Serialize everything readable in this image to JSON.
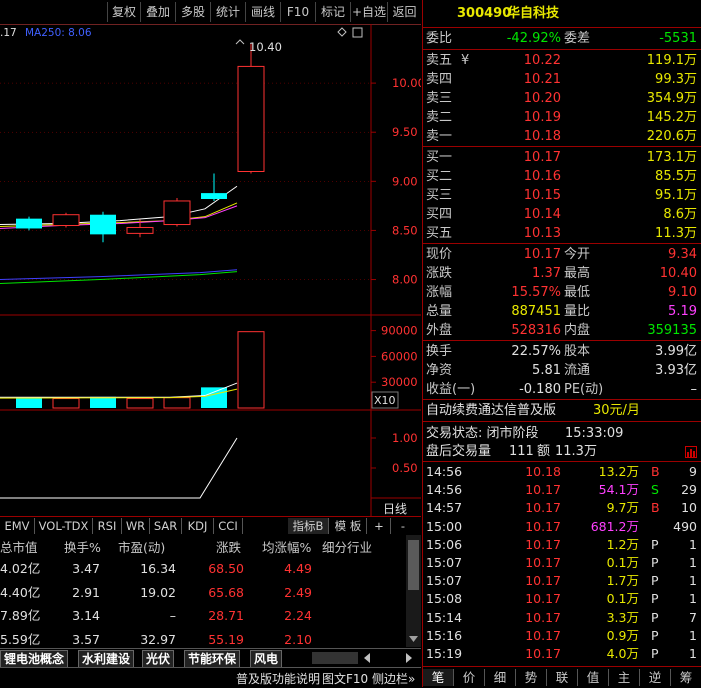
{
  "toolbar": {
    "buttons": [
      "复权",
      "叠加",
      "多股",
      "统计",
      "画线",
      "F10",
      "标记",
      "+自选",
      "返回"
    ]
  },
  "chart": {
    "ma_label_left": ".17",
    "ma_label": "MA250: 8.06",
    "high_marker": "10.40",
    "price_ticks": [
      "10.00",
      "9.50",
      "9.00",
      "8.50",
      "8.00"
    ],
    "vol_ticks": [
      "90000",
      "60000",
      "30000"
    ],
    "vol_unit": "X10",
    "ind_ticks": [
      "1.00",
      "0.50"
    ],
    "day_line_label": "日线",
    "plus": "+",
    "minus": "-"
  },
  "chart_data": {
    "type": "candlestick",
    "candles": [
      {
        "open": 8.62,
        "close": 8.52,
        "high": 8.64,
        "low": 8.5,
        "color": "cyan"
      },
      {
        "open": 8.55,
        "close": 8.66,
        "high": 8.68,
        "low": 8.53,
        "color": "red"
      },
      {
        "open": 8.66,
        "close": 8.46,
        "high": 8.69,
        "low": 8.38,
        "color": "cyan"
      },
      {
        "open": 8.47,
        "close": 8.53,
        "high": 8.61,
        "low": 8.43,
        "color": "red"
      },
      {
        "open": 8.56,
        "close": 8.8,
        "high": 8.83,
        "low": 8.54,
        "color": "red"
      },
      {
        "open": 8.88,
        "close": 8.82,
        "high": 9.08,
        "low": 8.8,
        "color": "cyan"
      },
      {
        "open": 9.1,
        "close": 10.17,
        "high": 10.4,
        "low": 9.08,
        "color": "red"
      }
    ],
    "volumes": [
      12000,
      11000,
      13000,
      11000,
      12000,
      24000,
      88745
    ],
    "indicator": [
      0,
      0,
      0,
      0,
      0,
      0.15,
      1.0
    ],
    "price_range": [
      7.7,
      10.5
    ],
    "vol_range": [
      0,
      100000
    ],
    "ind_range": [
      0,
      1.4
    ]
  },
  "indicator_tabs": [
    "EMV",
    "VOL-TDX",
    "RSI",
    "WR",
    "SAR",
    "KDJ",
    "CCI"
  ],
  "indicator_right": {
    "index_btn": "指标B",
    "template_btn": "模 板",
    "plus": "+",
    "minus": "-"
  },
  "block_table": {
    "headers": [
      "总市值",
      "换手%",
      "市盈(动)",
      "涨跌",
      "均涨幅%",
      "细分行业"
    ],
    "rows": [
      {
        "mcap": "4.02亿",
        "turnover": "3.47",
        "pe": "16.34",
        "change": "68.50",
        "avg": "4.49"
      },
      {
        "mcap": "4.40亿",
        "turnover": "2.91",
        "pe": "19.02",
        "change": "65.68",
        "avg": "2.49"
      },
      {
        "mcap": "7.89亿",
        "turnover": "3.14",
        "pe": "–",
        "change": "28.71",
        "avg": "2.24"
      },
      {
        "mcap": "5.59亿",
        "turnover": "3.57",
        "pe": "32.97",
        "change": "55.19",
        "avg": "2.10"
      }
    ]
  },
  "sector_tabs": [
    "锂电池概念",
    "水利建设",
    "光伏",
    "节能环保",
    "风电"
  ],
  "bottom_strip": {
    "help": "普及版功能说明",
    "f10": "图文F10",
    "sidebar": "侧边栏»"
  },
  "quote": {
    "code": "300490",
    "name": "华自科技",
    "webi_label": "委比",
    "webi": "-42.92%",
    "weicha_label": "委差",
    "weicha": "-5531",
    "asks": [
      {
        "label": "卖五",
        "price": "10.22",
        "vol": "119.1万",
        "flag": "¥"
      },
      {
        "label": "卖四",
        "price": "10.21",
        "vol": "99.3万"
      },
      {
        "label": "卖三",
        "price": "10.20",
        "vol": "354.9万"
      },
      {
        "label": "卖二",
        "price": "10.19",
        "vol": "145.2万"
      },
      {
        "label": "卖一",
        "price": "10.18",
        "vol": "220.6万"
      }
    ],
    "bids": [
      {
        "label": "买一",
        "price": "10.17",
        "vol": "173.1万"
      },
      {
        "label": "买二",
        "price": "10.16",
        "vol": "85.5万"
      },
      {
        "label": "买三",
        "price": "10.15",
        "vol": "95.1万"
      },
      {
        "label": "买四",
        "price": "10.14",
        "vol": "8.6万"
      },
      {
        "label": "买五",
        "price": "10.13",
        "vol": "11.3万"
      }
    ],
    "stats": [
      {
        "l1": "现价",
        "v1": "10.17",
        "c1": "red",
        "l2": "今开",
        "v2": "9.34",
        "c2": "red"
      },
      {
        "l1": "涨跌",
        "v1": "1.37",
        "c1": "red",
        "l2": "最高",
        "v2": "10.40",
        "c2": "red"
      },
      {
        "l1": "涨幅",
        "v1": "15.57%",
        "c1": "red",
        "l2": "最低",
        "v2": "9.10",
        "c2": "red"
      },
      {
        "l1": "总量",
        "v1": "887451",
        "c1": "yellow",
        "l2": "量比",
        "v2": "5.19",
        "c2": "magenta"
      },
      {
        "l1": "外盘",
        "v1": "528316",
        "c1": "red",
        "l2": "内盘",
        "v2": "359135",
        "c2": "green"
      }
    ],
    "fin": [
      {
        "l1": "换手",
        "v1": "22.57%",
        "l2": "股本",
        "v2": "3.99亿"
      },
      {
        "l1": "净资",
        "v1": "5.81",
        "l2": "流通",
        "v2": "3.93亿"
      },
      {
        "l1": "收益(一)",
        "v1": "-0.180",
        "l2": "PE(动)",
        "v2": "–"
      }
    ],
    "ad_text": "自动续费通达信普及版",
    "ad_price": "30元/月",
    "status_label": "交易状态: 闭市阶段",
    "status_time": "15:33:09",
    "after_label": "盘后交易量",
    "after_vol": "111",
    "after_amt_label": "额",
    "after_amt": "11.3万"
  },
  "ticks": [
    {
      "time": "14:56",
      "price": "10.18",
      "vol": "13.2万",
      "bs": "B",
      "n": "9",
      "vc": "yellow",
      "bc": "red"
    },
    {
      "time": "14:56",
      "price": "10.17",
      "vol": "54.1万",
      "bs": "S",
      "n": "29",
      "vc": "magenta",
      "bc": "green"
    },
    {
      "time": "14:57",
      "price": "10.17",
      "vol": "9.7万",
      "bs": "B",
      "n": "10",
      "vc": "yellow",
      "bc": "red"
    },
    {
      "time": "15:00",
      "price": "10.17",
      "vol": "681.2万",
      "bs": "",
      "n": "490",
      "vc": "magenta",
      "bc": "white"
    },
    {
      "time": "15:06",
      "price": "10.17",
      "vol": "1.2万",
      "bs": "P",
      "n": "1",
      "vc": "yellow",
      "bc": "white"
    },
    {
      "time": "15:07",
      "price": "10.17",
      "vol": "0.1万",
      "bs": "P",
      "n": "1",
      "vc": "yellow",
      "bc": "white"
    },
    {
      "time": "15:07",
      "price": "10.17",
      "vol": "1.7万",
      "bs": "P",
      "n": "1",
      "vc": "yellow",
      "bc": "white"
    },
    {
      "time": "15:08",
      "price": "10.17",
      "vol": "0.1万",
      "bs": "P",
      "n": "1",
      "vc": "yellow",
      "bc": "white"
    },
    {
      "time": "15:14",
      "price": "10.17",
      "vol": "3.3万",
      "bs": "P",
      "n": "7",
      "vc": "yellow",
      "bc": "white"
    },
    {
      "time": "15:16",
      "price": "10.17",
      "vol": "0.9万",
      "bs": "P",
      "n": "1",
      "vc": "yellow",
      "bc": "white"
    },
    {
      "time": "15:19",
      "price": "10.17",
      "vol": "4.0万",
      "bs": "P",
      "n": "1",
      "vc": "yellow",
      "bc": "white"
    }
  ],
  "right_tabs": [
    "笔",
    "价",
    "细",
    "势",
    "联",
    "值",
    "主",
    "逆",
    "筹"
  ],
  "colors": {
    "up": "#ff3232",
    "down": "#00ffff",
    "grid": "#9b0000",
    "ma1": "#ffffff",
    "ma2": "#e8e800",
    "ma3": "#ff40ff",
    "ma4": "#00e600",
    "ma5": "#4040ff"
  }
}
